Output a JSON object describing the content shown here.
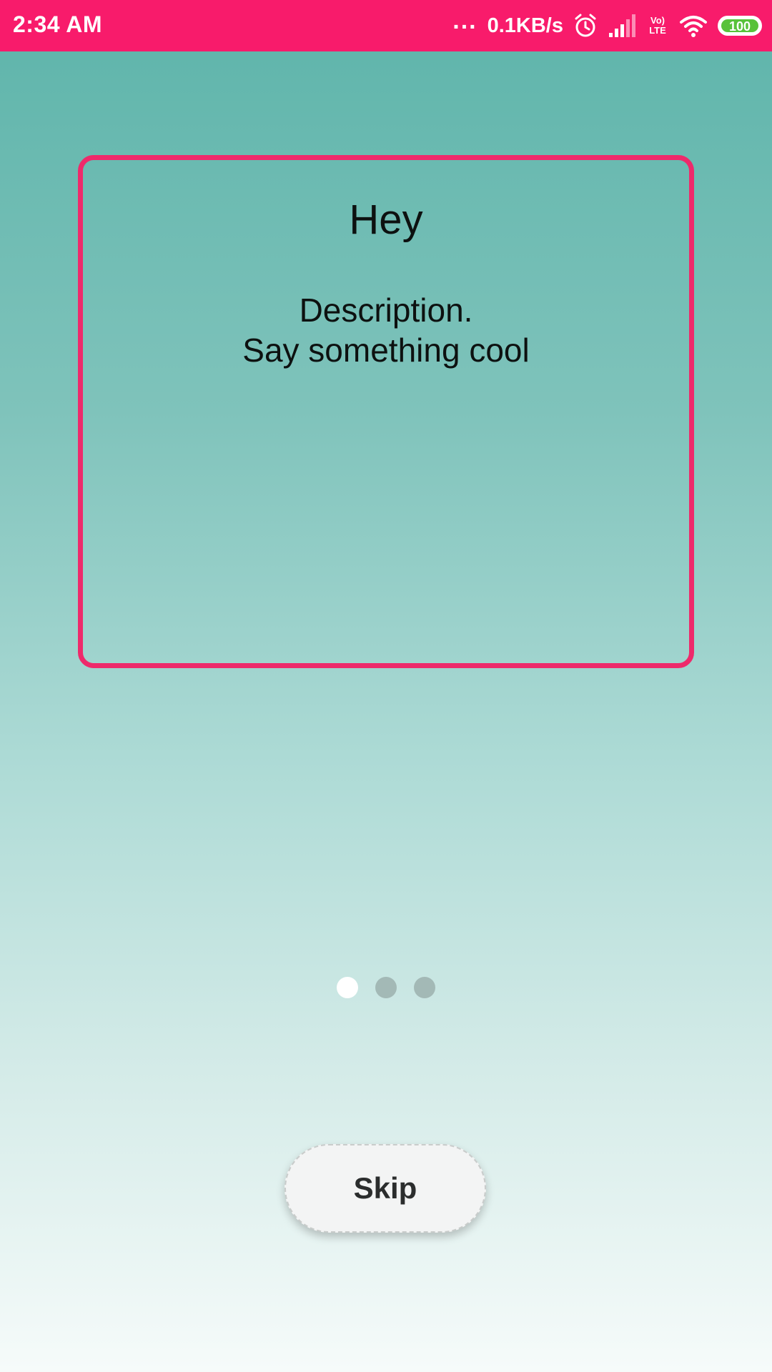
{
  "status_bar": {
    "time": "2:34 AM",
    "dots": "...",
    "network_speed": "0.1KB/s",
    "volte_line1": "Vo)",
    "volte_line2": "LTE",
    "battery_level": "100",
    "icons": [
      "alarm-icon",
      "signal-icon",
      "volte-icon",
      "wifi-icon",
      "battery-icon"
    ],
    "background_color": "#f81b6b"
  },
  "card": {
    "title": "Hey",
    "description_line1": "Description.",
    "description_line2": "Say something cool",
    "border_color": "#ee2a6b"
  },
  "pager": {
    "page_count": 3,
    "active_index": 0
  },
  "skip_button": {
    "label": "Skip"
  }
}
